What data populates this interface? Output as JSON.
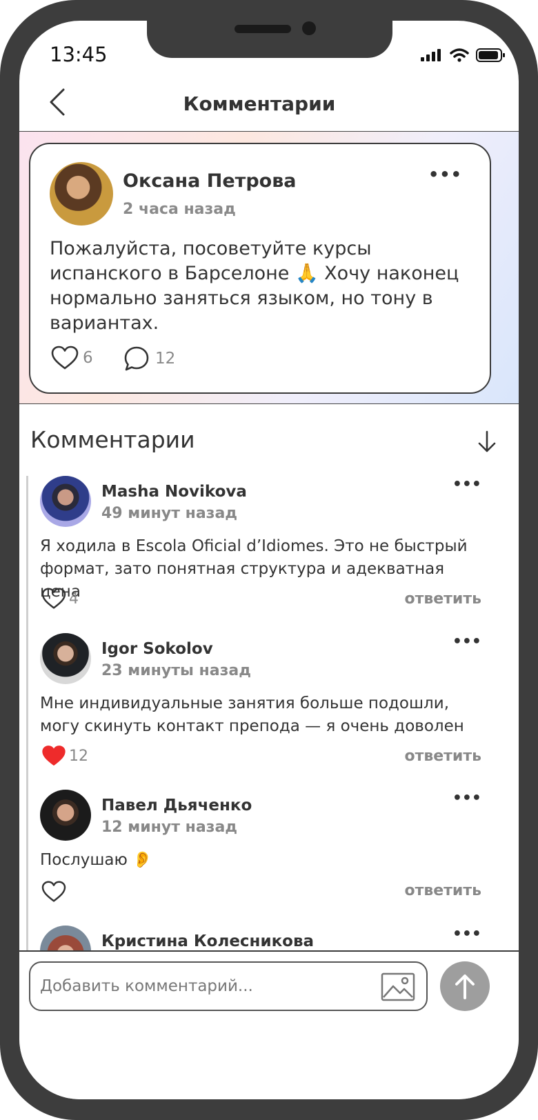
{
  "status_bar": {
    "time": "13:45"
  },
  "header": {
    "title": "Комментарии"
  },
  "post": {
    "author": "Оксана Петрова",
    "time": "2 часа назад",
    "text": "Пожалуйста, посоветуйте курсы испанского в Барселоне 🙏 Хочу наконец нормально заняться языком, но тону в вариантах.",
    "likes": "6",
    "comments": "12"
  },
  "comments_section": {
    "title": "Комментарии"
  },
  "comments": [
    {
      "author": "Masha Novikova",
      "time": "49 минут назад",
      "text": "Я ходила в Escola Oficial d’Idiomes. Это не быстрый формат, зато понятная структура и адекватная цена",
      "likes": "4",
      "liked": false,
      "reply": "ответить"
    },
    {
      "author": "Igor Sokolov",
      "time": "23 минуты назад",
      "text": "Мне индивидуальные занятия больше подошли, могу скинуть контакт препода — я очень доволен",
      "likes": "12",
      "liked": true,
      "reply": "ответить"
    },
    {
      "author": "Павел Дьяченко",
      "time": "12 минут назад",
      "text": "Послушаю 👂",
      "likes": "",
      "liked": false,
      "reply": "ответить"
    },
    {
      "author": "Кристина Колесникова"
    }
  ],
  "composer": {
    "placeholder": "Добавить комментарий..."
  },
  "colors": {
    "like_active": "#ee2b2b",
    "send_button": "#9e9e9e",
    "text_primary": "#333333",
    "text_secondary": "#888888"
  }
}
